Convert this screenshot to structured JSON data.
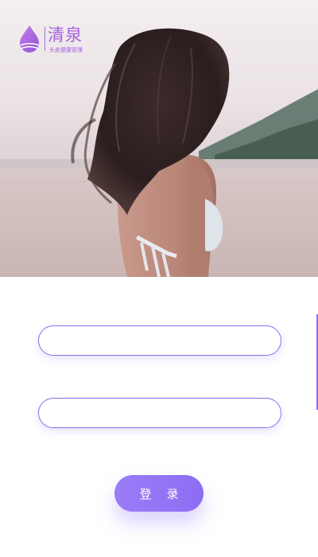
{
  "brand": {
    "name": "清泉",
    "tagline": "头皮健康管理",
    "color": "#a25ee0"
  },
  "hero": {
    "image": "woman-on-beach-photo"
  },
  "form": {
    "username": {
      "value": "",
      "placeholder": ""
    },
    "password": {
      "value": "",
      "placeholder": ""
    }
  },
  "login_button": {
    "label": "登    录"
  },
  "colors": {
    "accent": "#8f6cf0",
    "button": "#9a7cf6",
    "background": "#ffffff"
  }
}
